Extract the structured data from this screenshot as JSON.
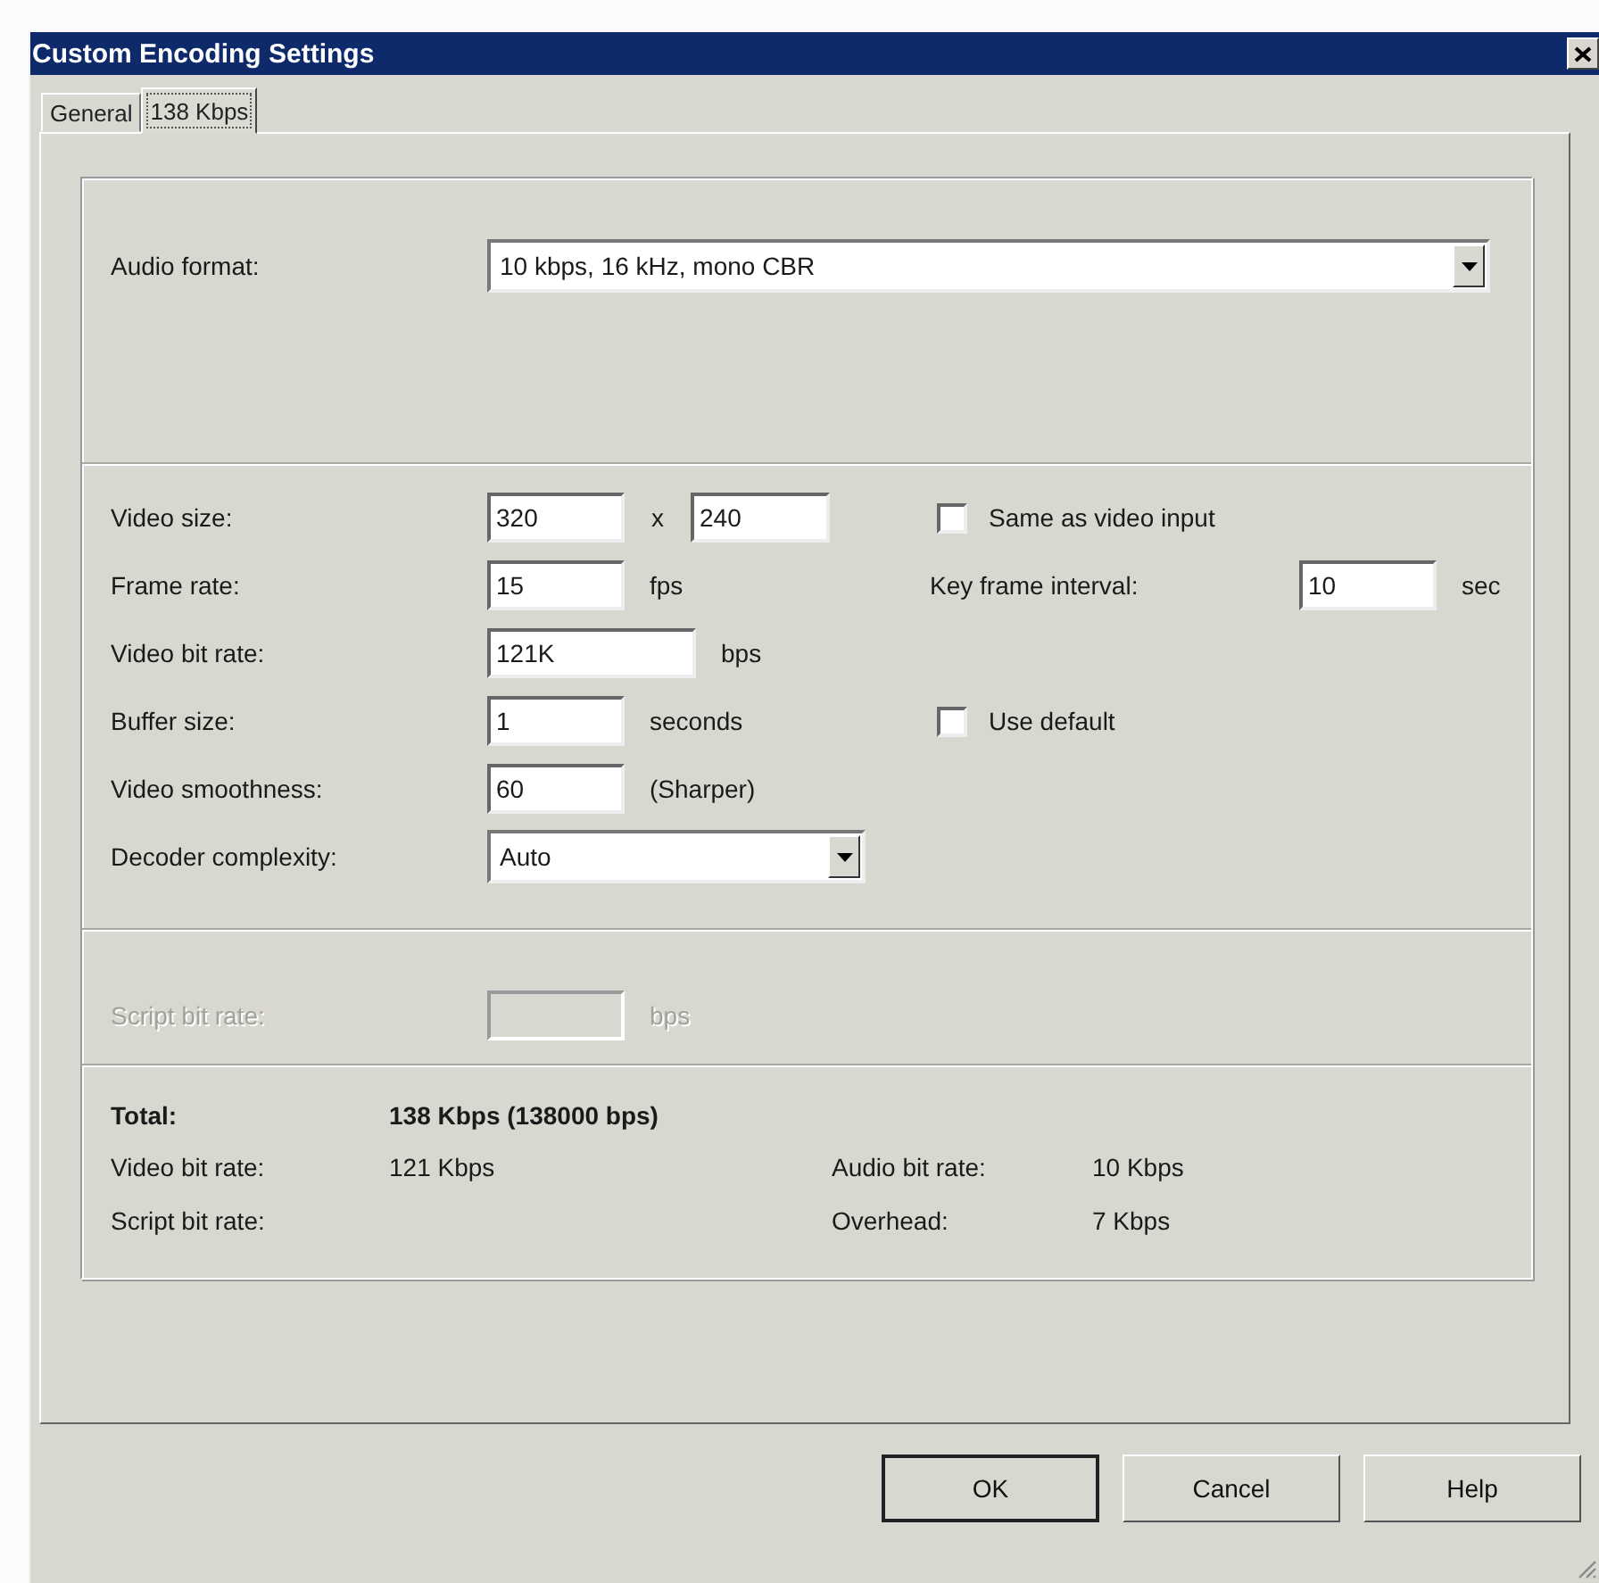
{
  "window": {
    "title": "Custom Encoding Settings"
  },
  "tabs": [
    {
      "label": "General",
      "selected": false
    },
    {
      "label": "138 Kbps",
      "selected": true
    }
  ],
  "audio": {
    "label": "Audio format:",
    "value": "10 kbps, 16 kHz, mono CBR"
  },
  "video_rows": [
    {
      "kind": "pair",
      "label": "Video size:",
      "value": "320",
      "separator": "x",
      "value_2": "240",
      "checkbox": {
        "label": "Same as video input",
        "checked": false
      }
    },
    {
      "kind": "field",
      "label": "Frame rate:",
      "value": "15",
      "unit": "fps",
      "side_field": {
        "label": "Key frame interval:",
        "value": "10",
        "unit": "sec"
      }
    },
    {
      "kind": "wide",
      "label": "Video bit rate:",
      "value": "121K",
      "unit": "bps"
    },
    {
      "kind": "field",
      "label": "Buffer size:",
      "value": "1",
      "unit": "seconds",
      "checkbox": {
        "label": "Use default",
        "checked": false
      }
    },
    {
      "kind": "field",
      "label": "Video smoothness:",
      "value": "60",
      "unit": "(Sharper)"
    },
    {
      "kind": "dropdown",
      "label": "Decoder complexity:",
      "value": "Auto"
    }
  ],
  "script": {
    "label": "Script bit rate:",
    "unit": "bps",
    "disabled": true
  },
  "summary": {
    "total_label": "Total:",
    "total_value": "138 Kbps (138000 bps)",
    "items": [
      {
        "label": "Video bit rate:",
        "value": "121 Kbps"
      },
      {
        "label": "Audio bit rate:",
        "value": "10 Kbps"
      },
      {
        "label": "Script bit rate:"
      },
      {
        "label": "Overhead:",
        "value": "7 Kbps"
      }
    ]
  },
  "buttons": [
    {
      "label": "OK",
      "default": true
    },
    {
      "label": "Cancel",
      "default": false
    },
    {
      "label": "Help",
      "default": false
    }
  ]
}
